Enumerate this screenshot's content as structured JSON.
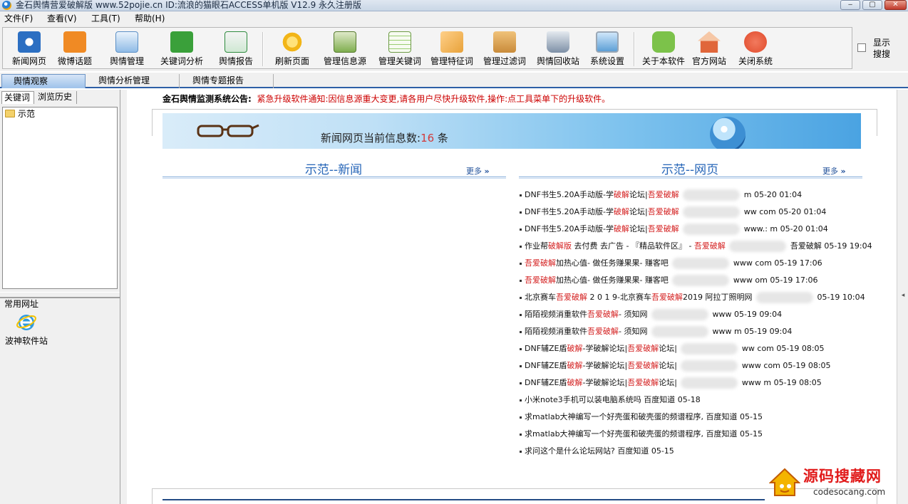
{
  "window": {
    "title": "金石舆情营爱破解版 www.52pojie.cn ID:流浪的猫眼石ACCESS单机版 V12.9 永久注册版",
    "buttons": {
      "minimize": "‒",
      "maximize": "▢",
      "close": "✕"
    }
  },
  "menu": [
    "文件(F)",
    "查看(V)",
    "工具(T)",
    "帮助(H)"
  ],
  "toolbar": {
    "items": [
      {
        "label": "新闻网页",
        "icon": "news-web-icon",
        "color": "#2c6fc2"
      },
      {
        "label": "微博话题",
        "icon": "rss-icon",
        "color": "#f08a24"
      },
      {
        "label": "舆情管理",
        "icon": "document-icon",
        "color": "#5b9bd5"
      },
      {
        "label": "关键词分析",
        "icon": "bar-chart-icon",
        "color": "#3aa03a"
      },
      {
        "label": "舆情报告",
        "icon": "excel-icon",
        "color": "#2e8b3e"
      },
      {
        "label": "刷新页面",
        "icon": "star-icon",
        "color": "#f2b517"
      },
      {
        "label": "管理信息源",
        "icon": "cabinet-icon",
        "color": "#7fae4f"
      },
      {
        "label": "管理关键词",
        "icon": "table-icon",
        "color": "#9acd72"
      },
      {
        "label": "管理特征词",
        "icon": "picture-icon",
        "color": "#e8a23a"
      },
      {
        "label": "管理过滤词",
        "icon": "folder-icon",
        "color": "#c98b3a"
      },
      {
        "label": "舆情回收站",
        "icon": "recycle-bin-icon",
        "color": "#7d8fa6"
      },
      {
        "label": "系统设置",
        "icon": "monitor-icon",
        "color": "#5d9fd6"
      },
      {
        "label": "关于本软件",
        "icon": "chat-bubble-icon",
        "color": "#7cc24a"
      },
      {
        "label": "官方网站",
        "icon": "home-icon",
        "color": "#e0663a"
      },
      {
        "label": "关闭系统",
        "icon": "close-circle-icon",
        "color": "#e04a2b"
      }
    ],
    "show_search": "显示搜搜"
  },
  "tabs": [
    "舆情观察",
    "舆情分析管理",
    "舆情专题报告"
  ],
  "left_panel": {
    "tabs": [
      "关键词",
      "浏览历史"
    ],
    "tree_items": [
      "示范"
    ],
    "links_title": "常用网址",
    "links": [
      {
        "label": "波神软件站",
        "icon": "ie-icon"
      }
    ]
  },
  "main": {
    "notice_label": "金石舆情监测系统公告:",
    "notice_text": "紧急升级软件通知:因信息源重大变更,请各用户尽快升级软件,操作:点工具菜单下的升级软件。",
    "banner": {
      "prefix": "新闻网页当前信息数:",
      "count": "16",
      "suffix": " 条"
    },
    "news_col_title": "示范--新闻",
    "web_col_title": "示范--网页",
    "more_label": "更多",
    "web_items": [
      {
        "parts": [
          [
            "DNF书生5.20A手动版-学",
            false
          ],
          [
            "破解",
            true
          ],
          [
            "论坛|",
            false
          ],
          [
            "吾爱破解",
            true
          ]
        ],
        "tail": "m 05-20 01:04"
      },
      {
        "parts": [
          [
            "DNF书生5.20A手动版-学",
            false
          ],
          [
            "破解",
            true
          ],
          [
            "论坛|",
            false
          ],
          [
            "吾爱破解",
            true
          ]
        ],
        "tail": "ww com 05-20 01:04"
      },
      {
        "parts": [
          [
            "DNF书生5.20A手动版-学",
            false
          ],
          [
            "破解",
            true
          ],
          [
            "论坛|",
            false
          ],
          [
            "吾爱破解",
            true
          ]
        ],
        "tail": "www.: m 05-20 01:04"
      },
      {
        "parts": [
          [
            "作业帮",
            false
          ],
          [
            "破解版",
            true
          ],
          [
            " 去付费 去广告 - 『精品软件区』 - ",
            false
          ],
          [
            "吾爱破解",
            true
          ]
        ],
        "tail": "吾爱破解 05-19 19:04"
      },
      {
        "parts": [
          [
            "吾爱破解",
            true
          ],
          [
            "加热心值- 做任务赚果果- 赚客吧",
            false
          ]
        ],
        "tail": "www com 05-19 17:06"
      },
      {
        "parts": [
          [
            "吾爱破解",
            true
          ],
          [
            "加热心值- 做任务赚果果- 赚客吧",
            false
          ]
        ],
        "tail": "www om 05-19 17:06"
      },
      {
        "parts": [
          [
            "北京赛车",
            false
          ],
          [
            "吾爱破解",
            true
          ],
          [
            " 2 0 1 9-北京赛车",
            false
          ],
          [
            "吾爱破解",
            true
          ],
          [
            "2019 阿拉丁照明网",
            false
          ]
        ],
        "tail": "05-19 10:04"
      },
      {
        "parts": [
          [
            "陌陌视频消重软件",
            false
          ],
          [
            "吾爱破解",
            true
          ],
          [
            "- 须知网",
            false
          ]
        ],
        "tail": "www 05-19 09:04"
      },
      {
        "parts": [
          [
            "陌陌视频消重软件",
            false
          ],
          [
            "吾爱破解",
            true
          ],
          [
            "- 须知网",
            false
          ]
        ],
        "tail": "www m 05-19 09:04"
      },
      {
        "parts": [
          [
            "DNF辅ZE盾",
            false
          ],
          [
            "破解",
            true
          ],
          [
            "-学破解论坛|",
            false
          ],
          [
            "吾爱破解",
            true
          ],
          [
            "论坛|",
            false
          ]
        ],
        "tail": "ww com 05-19 08:05"
      },
      {
        "parts": [
          [
            "DNF辅ZE盾",
            false
          ],
          [
            "破解",
            true
          ],
          [
            "-学破解论坛|",
            false
          ],
          [
            "吾爱破解",
            true
          ],
          [
            "论坛|",
            false
          ]
        ],
        "tail": "www com 05-19 08:05"
      },
      {
        "parts": [
          [
            "DNF辅ZE盾",
            false
          ],
          [
            "破解",
            true
          ],
          [
            "-学破解论坛|",
            false
          ],
          [
            "吾爱破解",
            true
          ],
          [
            "论坛|",
            false
          ]
        ],
        "tail": "www m 05-19 08:05"
      },
      {
        "parts": [
          [
            "小米note3手机可以装电脑系统吗 百度知道 05-18",
            false
          ]
        ],
        "tail": ""
      },
      {
        "parts": [
          [
            "求matlab大神编写一个好壳蛋和破壳蛋的频谱程序, 百度知道 05-15",
            false
          ]
        ],
        "tail": ""
      },
      {
        "parts": [
          [
            "求matlab大神编写一个好壳蛋和破壳蛋的频谱程序, 百度知道 05-15",
            false
          ]
        ],
        "tail": ""
      },
      {
        "parts": [
          [
            "求问这个是什么论坛网站? 百度知道 05-15",
            false
          ]
        ],
        "tail": ""
      }
    ]
  },
  "watermark": {
    "cn": "源码搜藏网",
    "en": "codesocang.com"
  }
}
